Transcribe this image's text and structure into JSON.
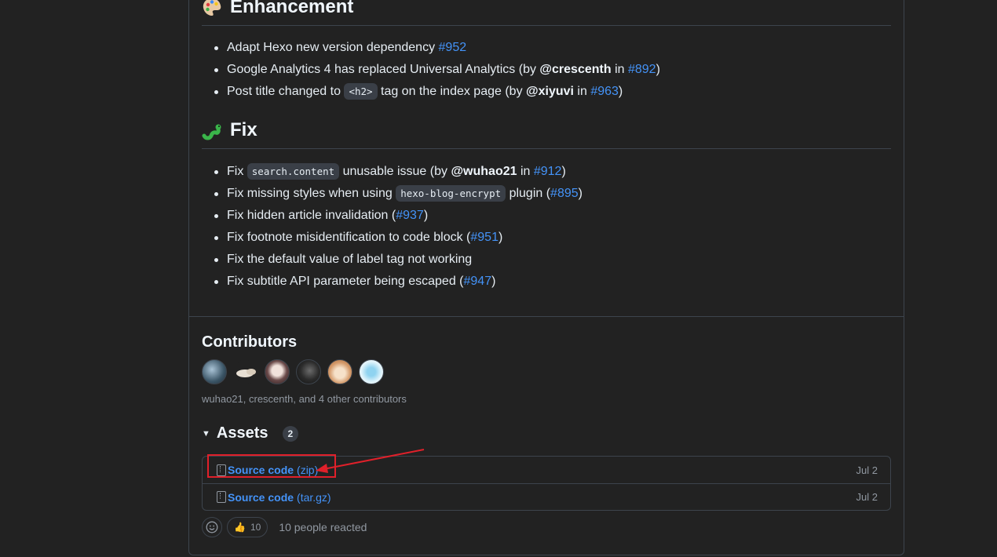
{
  "enhancement": {
    "title": "Enhancement",
    "items": [
      {
        "t1": "Adapt Hexo new version dependency ",
        "link": "#952"
      },
      {
        "t1": "Google Analytics 4 has replaced Universal Analytics (by ",
        "user": "@crescenth",
        "t2": " in ",
        "link": "#892",
        "t3": ")"
      },
      {
        "t1": "Post title changed to ",
        "code": "<h2>",
        "t2": " tag on the index page (by ",
        "user": "@xiyuvi",
        "t3": " in ",
        "link": "#963",
        "t4": ")"
      }
    ]
  },
  "fix": {
    "title": "Fix",
    "items": [
      {
        "t1": "Fix ",
        "code": "search.content",
        "t2": " unusable issue (by ",
        "user": "@wuhao21",
        "t3": " in ",
        "link": "#912",
        "t4": ")"
      },
      {
        "t1": "Fix missing styles when using ",
        "code": "hexo-blog-encrypt",
        "t2": " plugin (",
        "link": "#895",
        "t3": ")"
      },
      {
        "t1": "Fix hidden article invalidation (",
        "link": "#937",
        "t2": ")"
      },
      {
        "t1": "Fix footnote misidentification to code block (",
        "link": "#951",
        "t2": ")"
      },
      {
        "t1": "Fix the default value of label tag not working"
      },
      {
        "t1": "Fix subtitle API parameter being escaped (",
        "link": "#947",
        "t2": ")"
      }
    ]
  },
  "contributors": {
    "title": "Contributors",
    "summary": "wuhao21, crescenth, and 4 other contributors"
  },
  "assets": {
    "title": "Assets",
    "count": "2",
    "files": [
      {
        "name": "Source code",
        "ext": "(zip)",
        "date": "Jul 2"
      },
      {
        "name": "Source code",
        "ext": "(tar.gz)",
        "date": "Jul 2"
      }
    ]
  },
  "reactions": {
    "thumbs_emoji": "👍",
    "thumbs_count": "10",
    "summary": "10 people reacted"
  },
  "colors": {
    "background": "#222222",
    "link": "#4493f8",
    "annotation_red": "#e0202a"
  }
}
